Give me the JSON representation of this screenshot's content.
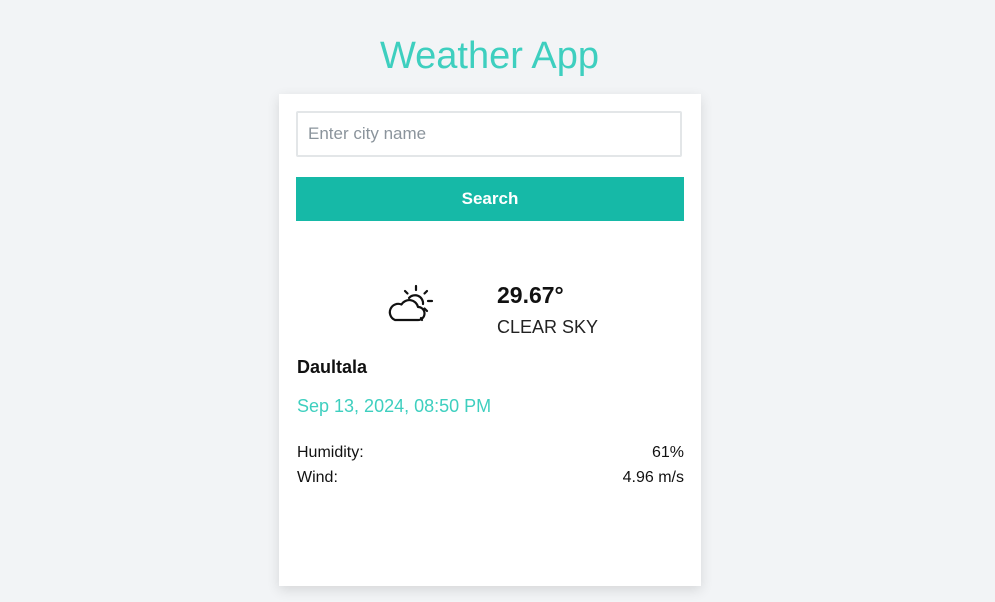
{
  "app": {
    "title": "Weather App"
  },
  "search": {
    "placeholder": "Enter city name",
    "value": "",
    "button_label": "Search"
  },
  "weather": {
    "icon": "partly-cloudy-icon",
    "temperature": "29.67°",
    "description": "CLEAR SKY",
    "city": "Daultala",
    "datetime": "Sep 13, 2024, 08:50 PM",
    "stats": {
      "humidity_label": "Humidity:",
      "humidity_value": "61%",
      "wind_label": "Wind:",
      "wind_value": "4.96 m/s"
    }
  },
  "colors": {
    "accent": "#3ecfbf",
    "button": "#16b9a7",
    "background": "#f2f4f6"
  }
}
